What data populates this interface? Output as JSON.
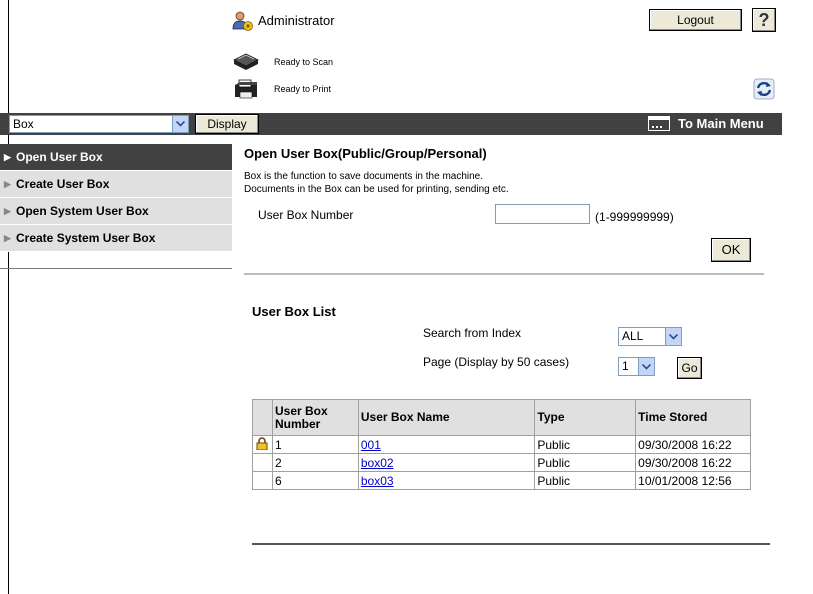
{
  "header": {
    "user_label": "Administrator",
    "logout_label": "Logout",
    "help_label": "?",
    "status": [
      {
        "icon": "scanner-icon",
        "text": "Ready to Scan"
      },
      {
        "icon": "printer-icon",
        "text": "Ready to Print"
      }
    ],
    "refresh_icon": "refresh-icon"
  },
  "toolbar": {
    "mode_select_value": "Box",
    "display_label": "Display",
    "main_menu_label": "To Main Menu"
  },
  "sidebar": {
    "items": [
      {
        "label": "Open User Box",
        "active": true
      },
      {
        "label": "Create User Box",
        "active": false
      },
      {
        "label": "Open System User Box",
        "active": false
      },
      {
        "label": "Create System User Box",
        "active": false
      }
    ]
  },
  "main": {
    "title": "Open User Box(Public/Group/Personal)",
    "desc_line1": "Box is the function to save documents in the machine.",
    "desc_line2": "Documents in the Box can be used for printing, sending etc.",
    "box_number_label": "User Box Number",
    "box_number_value": "",
    "box_number_range": "(1-999999999)",
    "ok_label": "OK",
    "list_title": "User Box List",
    "search_label": "Search from Index",
    "search_value": "ALL",
    "page_label": "Page (Display by 50 cases)",
    "page_value": "1",
    "go_label": "Go"
  },
  "table": {
    "headers": [
      "",
      "User Box Number",
      "User Box Name",
      "Type",
      "Time Stored"
    ],
    "rows": [
      {
        "locked": true,
        "number": "1",
        "name": "001",
        "type": "Public",
        "time": "09/30/2008 16:22"
      },
      {
        "locked": false,
        "number": "2",
        "name": "box02",
        "type": "Public",
        "time": "09/30/2008 16:22"
      },
      {
        "locked": false,
        "number": "6",
        "name": "box03",
        "type": "Public",
        "time": "10/01/2008 12:56"
      }
    ]
  },
  "colors": {
    "bar": "#414141",
    "sidebar_item": "#e0e0e0",
    "link": "#0000cc"
  }
}
